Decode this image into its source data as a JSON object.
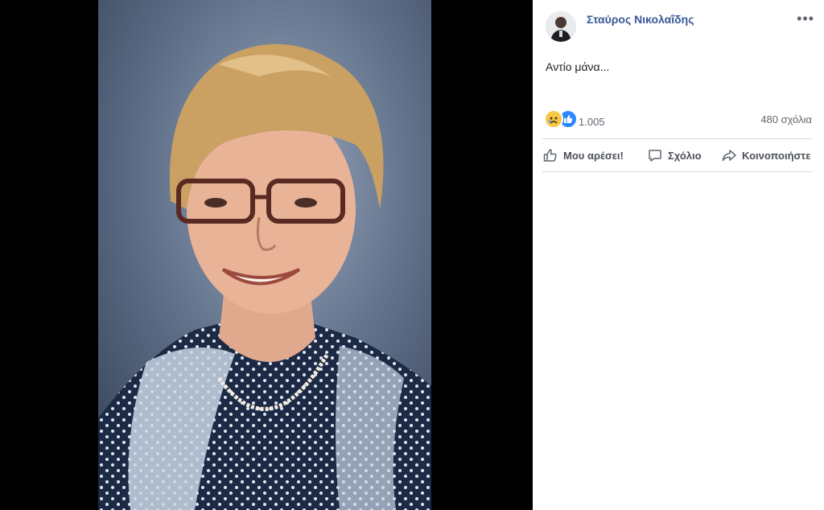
{
  "post": {
    "author": "Σταύρος Νικολαΐδης",
    "more_icon": "more-icon",
    "text": "Αντίο μάνα...",
    "reactions": {
      "icons": [
        "sad-reaction-icon",
        "like-reaction-icon"
      ],
      "count": "1.005"
    },
    "comments_count": "480 σχόλια",
    "actions": {
      "like": "Μου αρέσει!",
      "comment": "Σχόλιο",
      "share": "Κοινοποιήστε"
    }
  },
  "colors": {
    "author_link": "#385898",
    "like_blue": "#2d88ff",
    "sad_yellow": "#f7c844",
    "photo_backdrop": "#000000"
  }
}
